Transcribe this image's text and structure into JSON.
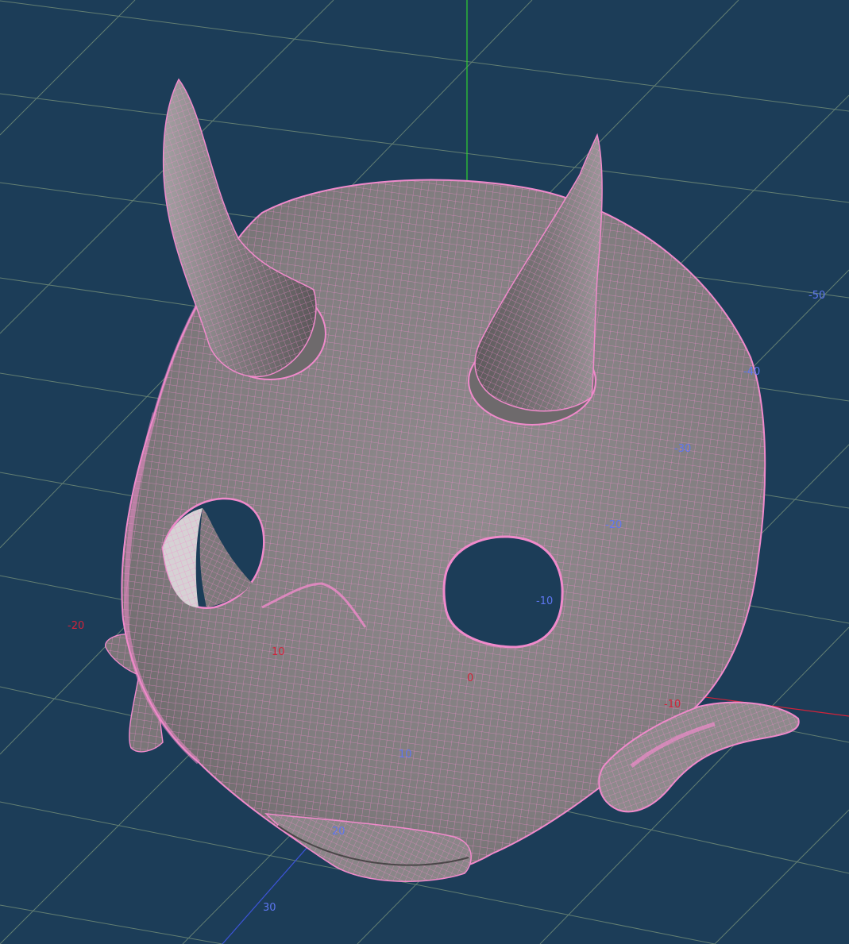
{
  "viewport": {
    "background_color": "#1c3d58",
    "grid_color": "#6f8a77",
    "mesh_color": "#f08acb",
    "surface_color": "#8e8a8c",
    "axis_colors": {
      "x": "#d2233a",
      "y": "#2fd12f",
      "z": "#3d54d8"
    }
  },
  "axis_labels": {
    "red": [
      "-20",
      "10",
      "0",
      "-10"
    ],
    "blue": [
      "-50",
      "-40",
      "-30",
      "-20",
      "-10",
      "10",
      "20",
      "30"
    ]
  },
  "model": {
    "name": "horned-mask",
    "parts": [
      "left-horn",
      "right-horn",
      "left-eye-hole",
      "right-eye-hole",
      "left-ear",
      "right-ear",
      "nose",
      "mouth-opening"
    ]
  }
}
